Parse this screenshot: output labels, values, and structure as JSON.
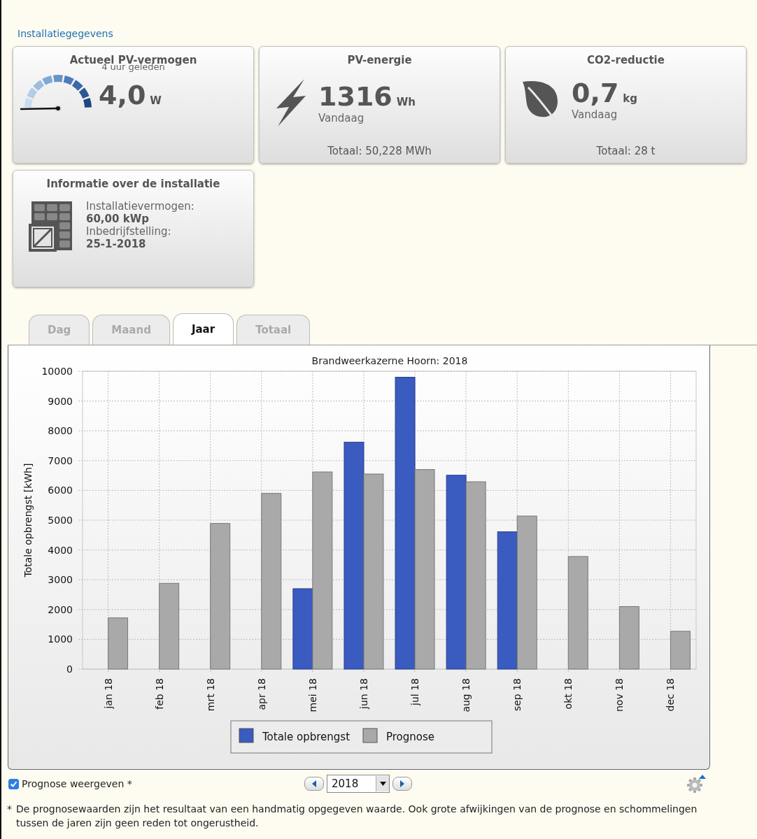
{
  "section_title": "Installatiegegevens",
  "cards": [
    {
      "kind": "power",
      "title": "Actueel PV-vermogen",
      "subtitle": "4 uur geleden",
      "value": "4,0",
      "unit": "W"
    },
    {
      "kind": "energy",
      "title": "PV-energie",
      "value": "1316",
      "unit": "Wh",
      "caption": "Vandaag",
      "total": "Totaal: 50,228 MWh"
    },
    {
      "kind": "co2",
      "title": "CO2-reductie",
      "value": "0,7",
      "unit": "kg",
      "caption": "Vandaag",
      "total": "Totaal: 28 t"
    },
    {
      "kind": "info",
      "title": "Informatie over de installatie",
      "rows": [
        {
          "label": "Installatievermogen:",
          "value": "60,00 kWp"
        },
        {
          "label": "Inbedrijfstelling:",
          "value": "25-1-2018"
        }
      ]
    }
  ],
  "tabs": [
    {
      "label": "Dag",
      "selected": false
    },
    {
      "label": "Maand",
      "selected": false
    },
    {
      "label": "Jaar",
      "selected": true
    },
    {
      "label": "Totaal",
      "selected": false
    }
  ],
  "chart": {
    "chart_data": {
      "type": "bar",
      "title": "Brandweerkazerne Hoorn: 2018",
      "ylabel": "Totale opbrengst [kWh]",
      "categories": [
        "jan 18",
        "feb 18",
        "mrt 18",
        "apr 18",
        "mei 18",
        "jun 18",
        "jul 18",
        "aug 18",
        "sep 18",
        "okt 18",
        "nov 18",
        "dec 18"
      ],
      "series": [
        {
          "name": "Totale opbrengst",
          "color": "#3a5bbf",
          "values": [
            null,
            null,
            null,
            null,
            2700,
            7620,
            9800,
            6510,
            4610,
            null,
            null,
            null
          ]
        },
        {
          "name": "Prognose",
          "color": "#a9a9a9",
          "values": [
            1720,
            2880,
            4890,
            5900,
            6620,
            6550,
            6700,
            6290,
            5140,
            3780,
            2100,
            1270
          ]
        }
      ],
      "ylim": [
        0,
        10000
      ],
      "grid": true,
      "yticks": [
        0,
        1000,
        2000,
        3000,
        4000,
        5000,
        6000,
        7000,
        8000,
        9000,
        10000
      ]
    }
  },
  "prognosis_toggle": {
    "label": "Prognose weergeven *",
    "checked": true
  },
  "year_picker": {
    "value": "2018"
  },
  "footnote": {
    "mark": "*",
    "text": "De prognosewaarden zijn het resultaat van een handmatig opgegeven waarde. Ook grote afwijkingen van de prognose en schommelingen tussen de jaren zijn geen reden tot ongerustheid."
  }
}
